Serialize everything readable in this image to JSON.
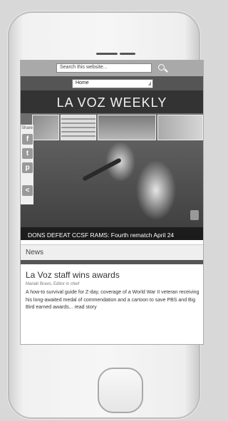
{
  "search": {
    "placeholder": "Search this website..."
  },
  "nav": {
    "selected": "Home"
  },
  "site": {
    "title": "LA VOZ WEEKLY"
  },
  "hero": {
    "caption": "DONS DEFEAT CCSF RAMS: Fourth rematch April 24"
  },
  "share": {
    "label": "Share",
    "buttons": [
      {
        "icon": "facebook-icon",
        "glyph": "f"
      },
      {
        "icon": "twitter-icon",
        "glyph": "t"
      },
      {
        "icon": "pin-icon",
        "glyph": "p"
      },
      {
        "icon": "share-icon",
        "glyph": "<"
      }
    ]
  },
  "news": {
    "section": "News",
    "headline": "La Voz staff wins awards",
    "byline": "Mariah Bravo, Editor in chief",
    "summary": "A how-to survival guide for Z-day, coverage of a World War II veteran receiving his long-awaited medal of commendation and a cartoon to save PBS and Big Bird earned awards... read story"
  },
  "colors": {
    "nav_bg": "#555555",
    "title_bg": "#333333",
    "searchbar_bg": "#a9a9a9"
  }
}
